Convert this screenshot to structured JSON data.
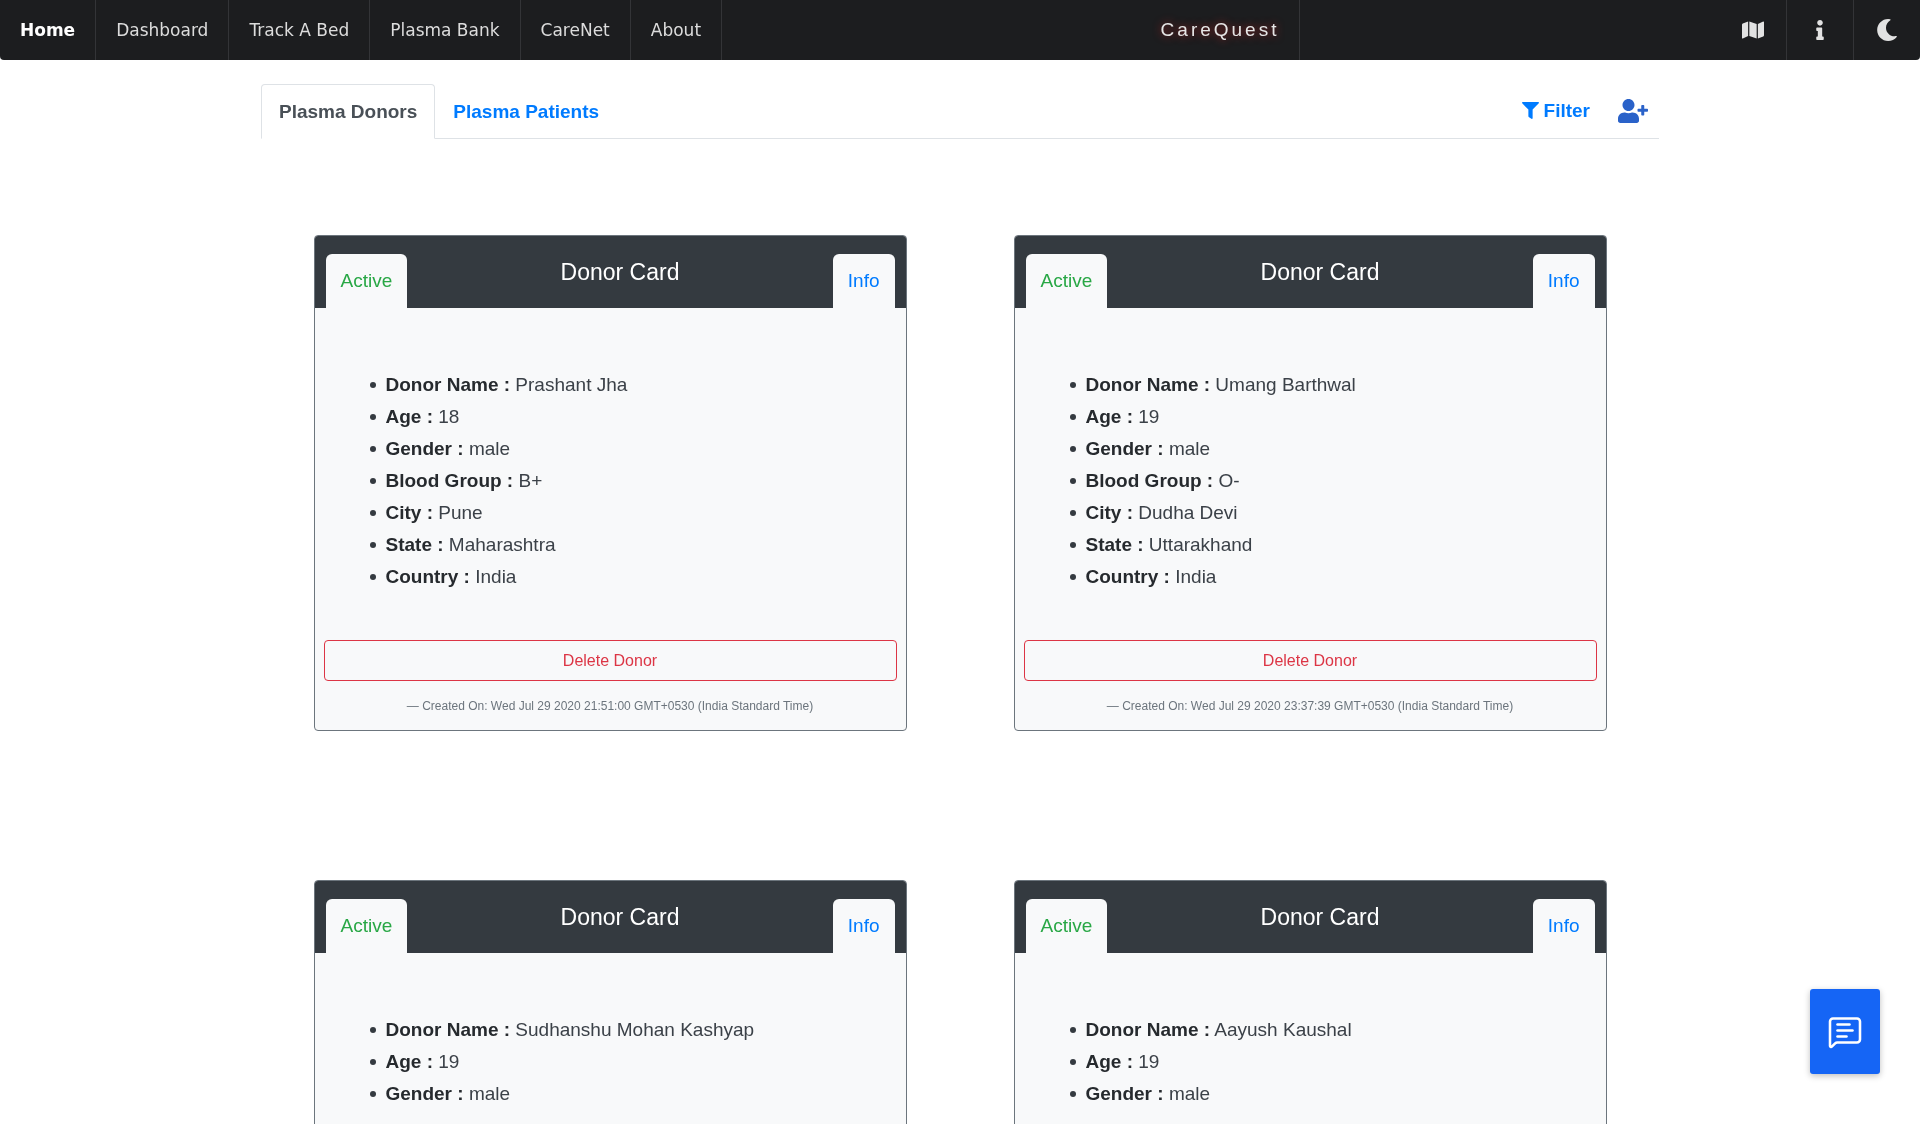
{
  "navbar": {
    "items": [
      {
        "label": "Home",
        "selected": true
      },
      {
        "label": "Dashboard",
        "selected": false
      },
      {
        "label": "Track A Bed",
        "selected": false
      },
      {
        "label": "Plasma Bank",
        "selected": false
      },
      {
        "label": "CareNet",
        "selected": false
      },
      {
        "label": "About",
        "selected": false
      }
    ],
    "brand": "CareQuest"
  },
  "tabs": [
    {
      "label": "Plasma Donors",
      "selected": true
    },
    {
      "label": "Plasma Patients",
      "selected": false
    }
  ],
  "filter": {
    "label": "Filter"
  },
  "cards": [
    {
      "title": "Donor Card",
      "status": {
        "label": "Active",
        "active": true
      },
      "info": "Info",
      "fields": [
        {
          "label": "Donor Name :",
          "value": "Prashant Jha"
        },
        {
          "label": "Age :",
          "value": "18"
        },
        {
          "label": "Gender :",
          "value": "male"
        },
        {
          "label": "Blood Group :",
          "value": "B+"
        },
        {
          "label": "City :",
          "value": "Pune"
        },
        {
          "label": "State :",
          "value": "Maharashtra"
        },
        {
          "label": "Country :",
          "value": "India"
        }
      ],
      "delete_button": "Delete Donor",
      "created": "— Created On: Wed Jul 29 2020 21:51:00 GMT+0530 (India Standard Time)"
    },
    {
      "title": "Donor Card",
      "status": {
        "label": "Active",
        "active": true
      },
      "info": "Info",
      "fields": [
        {
          "label": "Donor Name :",
          "value": "Umang Barthwal"
        },
        {
          "label": "Age :",
          "value": "19"
        },
        {
          "label": "Gender :",
          "value": "male"
        },
        {
          "label": "Blood Group :",
          "value": "O-"
        },
        {
          "label": "City :",
          "value": "Dudha Devi"
        },
        {
          "label": "State :",
          "value": "Uttarakhand"
        },
        {
          "label": "Country :",
          "value": "India"
        }
      ],
      "delete_button": "Delete Donor",
      "created": "— Created On: Wed Jul 29 2020 23:37:39 GMT+0530 (India Standard Time)"
    },
    {
      "title": "Donor Card",
      "status": {
        "label": "Active",
        "active": true
      },
      "info": "Info",
      "fields": [
        {
          "label": "Donor Name :",
          "value": "Sudhanshu Mohan Kashyap"
        },
        {
          "label": "Age :",
          "value": "19"
        },
        {
          "label": "Gender :",
          "value": "male"
        }
      ]
    },
    {
      "title": "Donor Card",
      "status": {
        "label": "Active",
        "active": true
      },
      "info": "Info",
      "fields": [
        {
          "label": "Donor Name :",
          "value": "Aayush Kaushal"
        },
        {
          "label": "Age :",
          "value": "19"
        },
        {
          "label": "Gender :",
          "value": "male"
        }
      ]
    }
  ]
}
